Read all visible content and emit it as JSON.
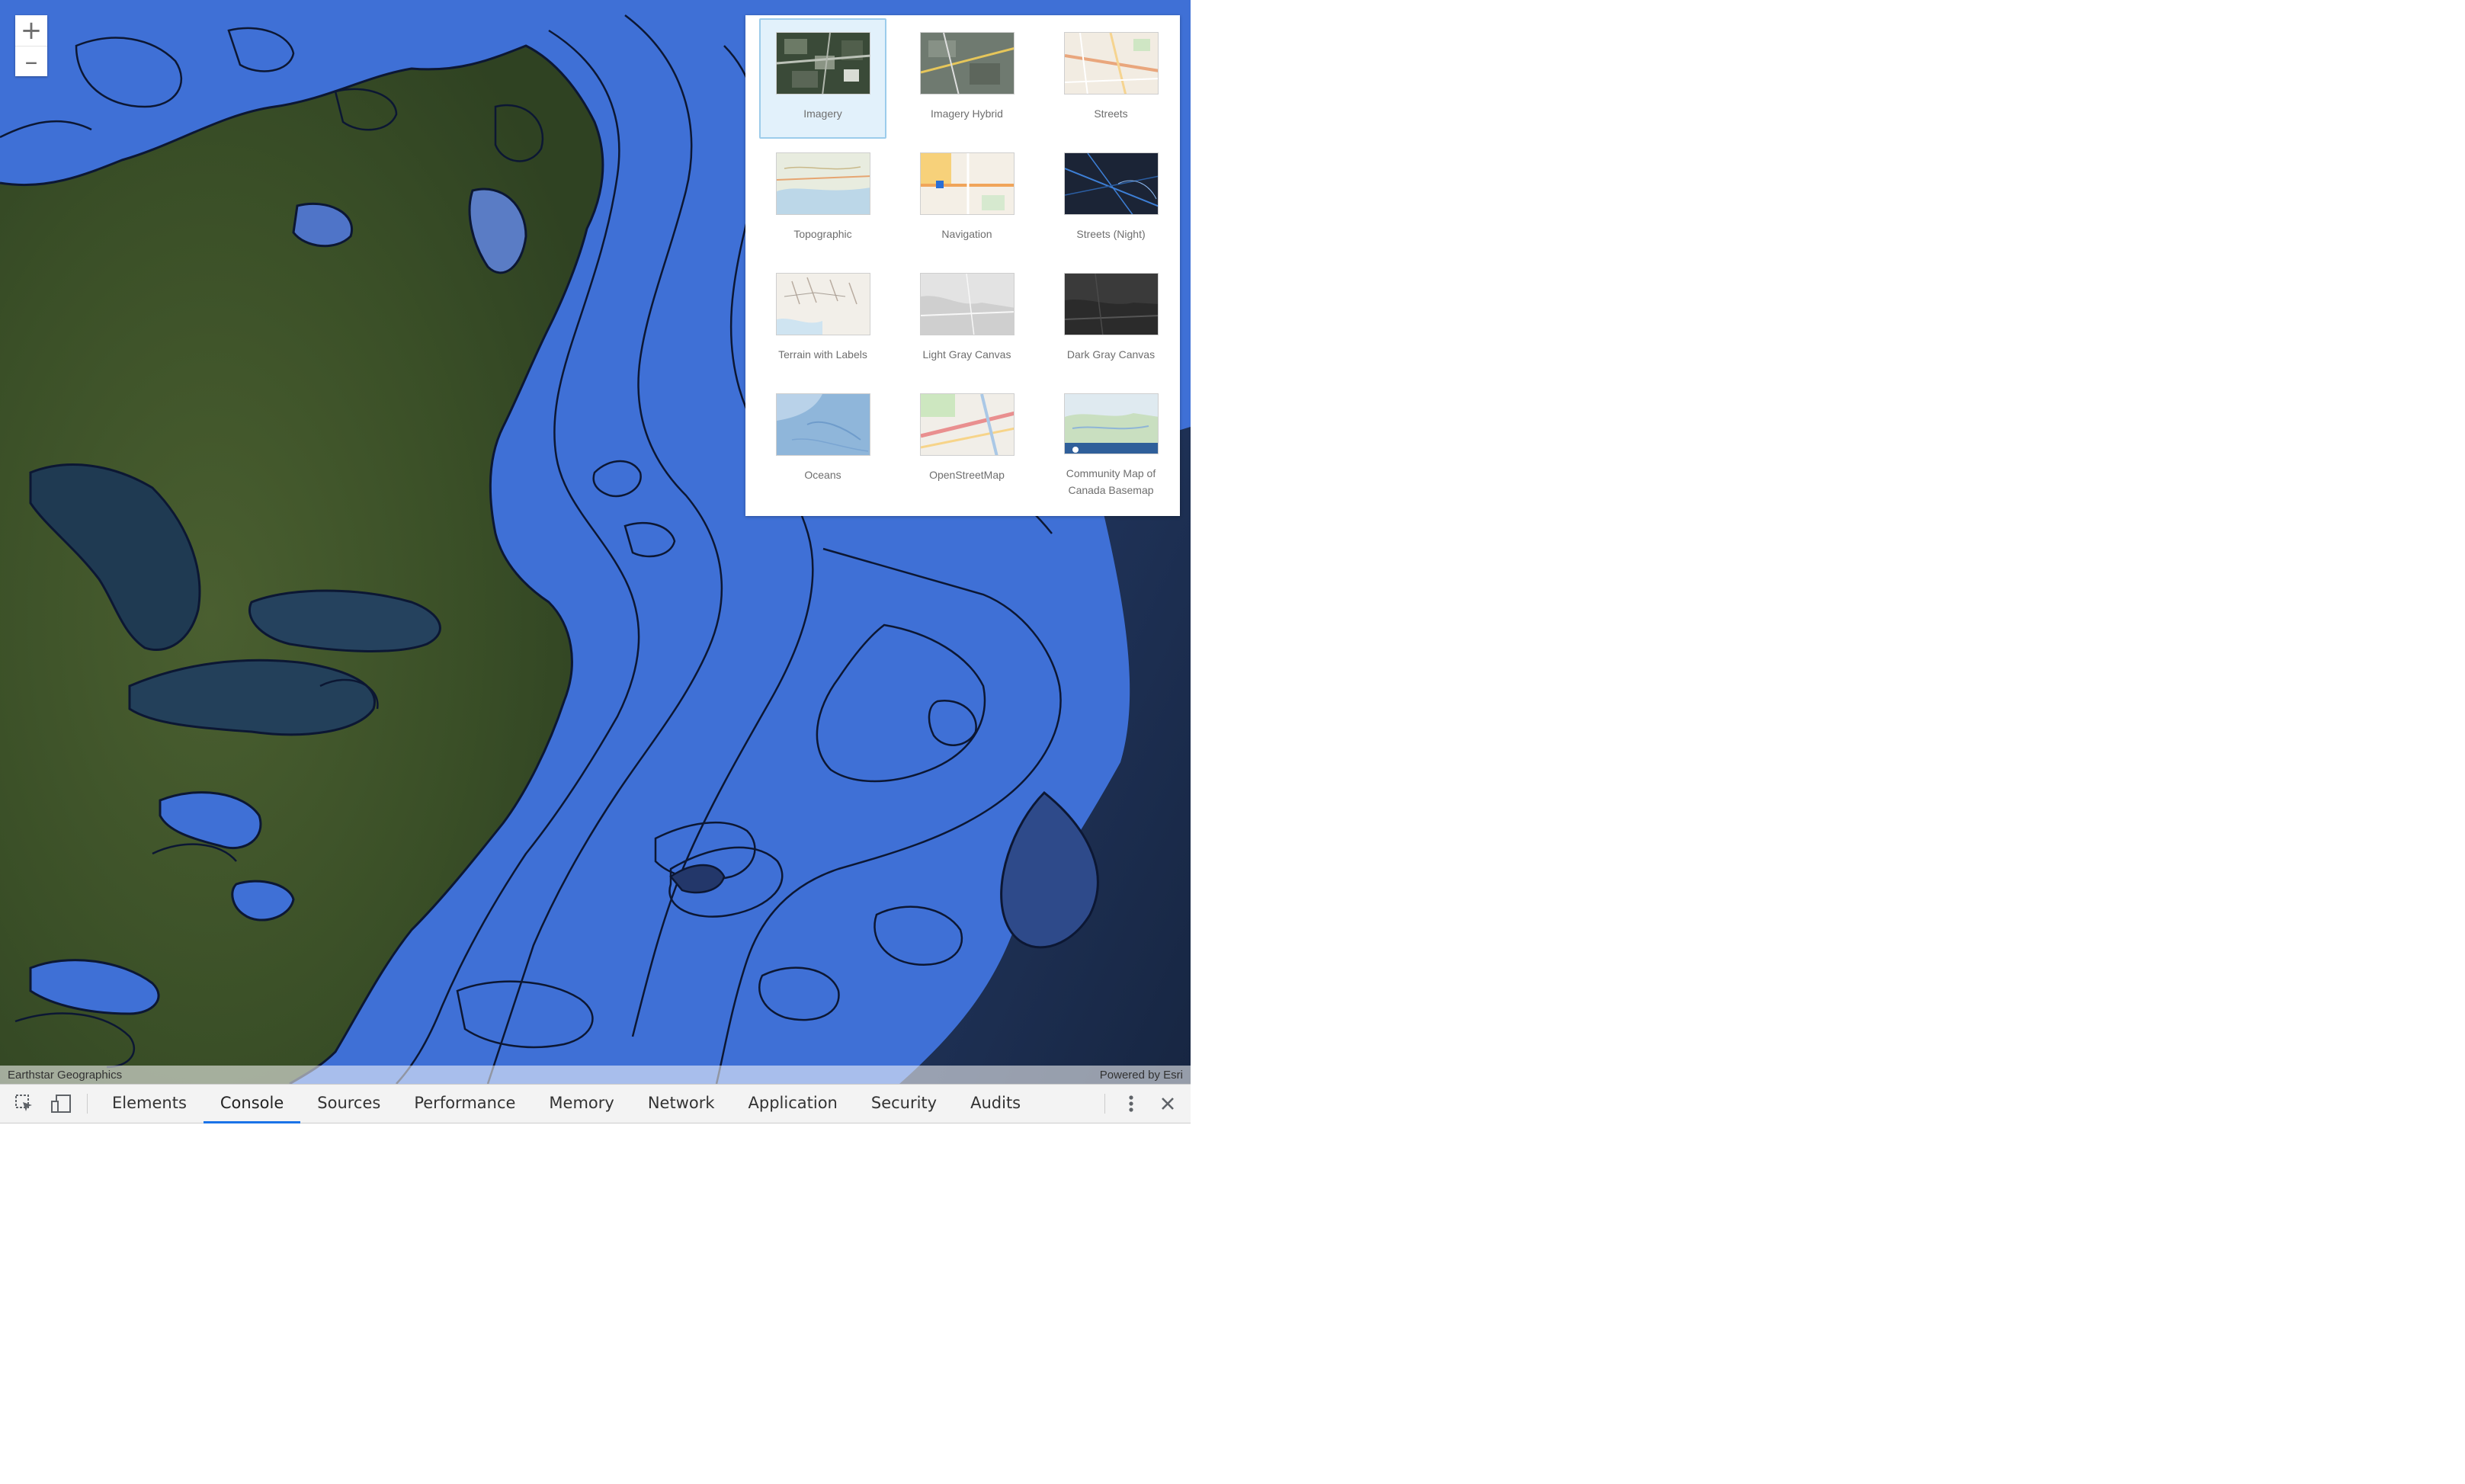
{
  "zoom": {
    "in_symbol": "+",
    "out_symbol": "–"
  },
  "basemap_gallery": {
    "selected": "Imagery",
    "items": [
      {
        "label": "Imagery",
        "icon": "imagery-thumbnail"
      },
      {
        "label": "Imagery Hybrid",
        "icon": "imagery-hybrid-thumbnail"
      },
      {
        "label": "Streets",
        "icon": "streets-thumbnail"
      },
      {
        "label": "Topographic",
        "icon": "topographic-thumbnail"
      },
      {
        "label": "Navigation",
        "icon": "navigation-thumbnail"
      },
      {
        "label": "Streets (Night)",
        "icon": "streets-night-thumbnail"
      },
      {
        "label": "Terrain with Labels",
        "icon": "terrain-thumbnail"
      },
      {
        "label": "Light Gray Canvas",
        "icon": "light-gray-thumbnail"
      },
      {
        "label": "Dark Gray Canvas",
        "icon": "dark-gray-thumbnail"
      },
      {
        "label": "Oceans",
        "icon": "oceans-thumbnail"
      },
      {
        "label": "OpenStreetMap",
        "icon": "osm-thumbnail"
      },
      {
        "label": "Community Map of Canada Basemap",
        "icon": "canada-thumbnail"
      }
    ]
  },
  "attribution": {
    "left": "Earthstar Geographics",
    "right": "Powered by Esri"
  },
  "devtools": {
    "tabs": [
      "Elements",
      "Console",
      "Sources",
      "Performance",
      "Memory",
      "Network",
      "Application",
      "Security",
      "Audits"
    ],
    "active_tab": "Console"
  },
  "colors": {
    "ocean_contour_fill": "#3f70d6",
    "land_green": "#3c5229",
    "deep_ocean": "#1d2e52",
    "devtools_active_underline": "#1a73e8",
    "selected_tile_bg": "#e2f1fb"
  }
}
